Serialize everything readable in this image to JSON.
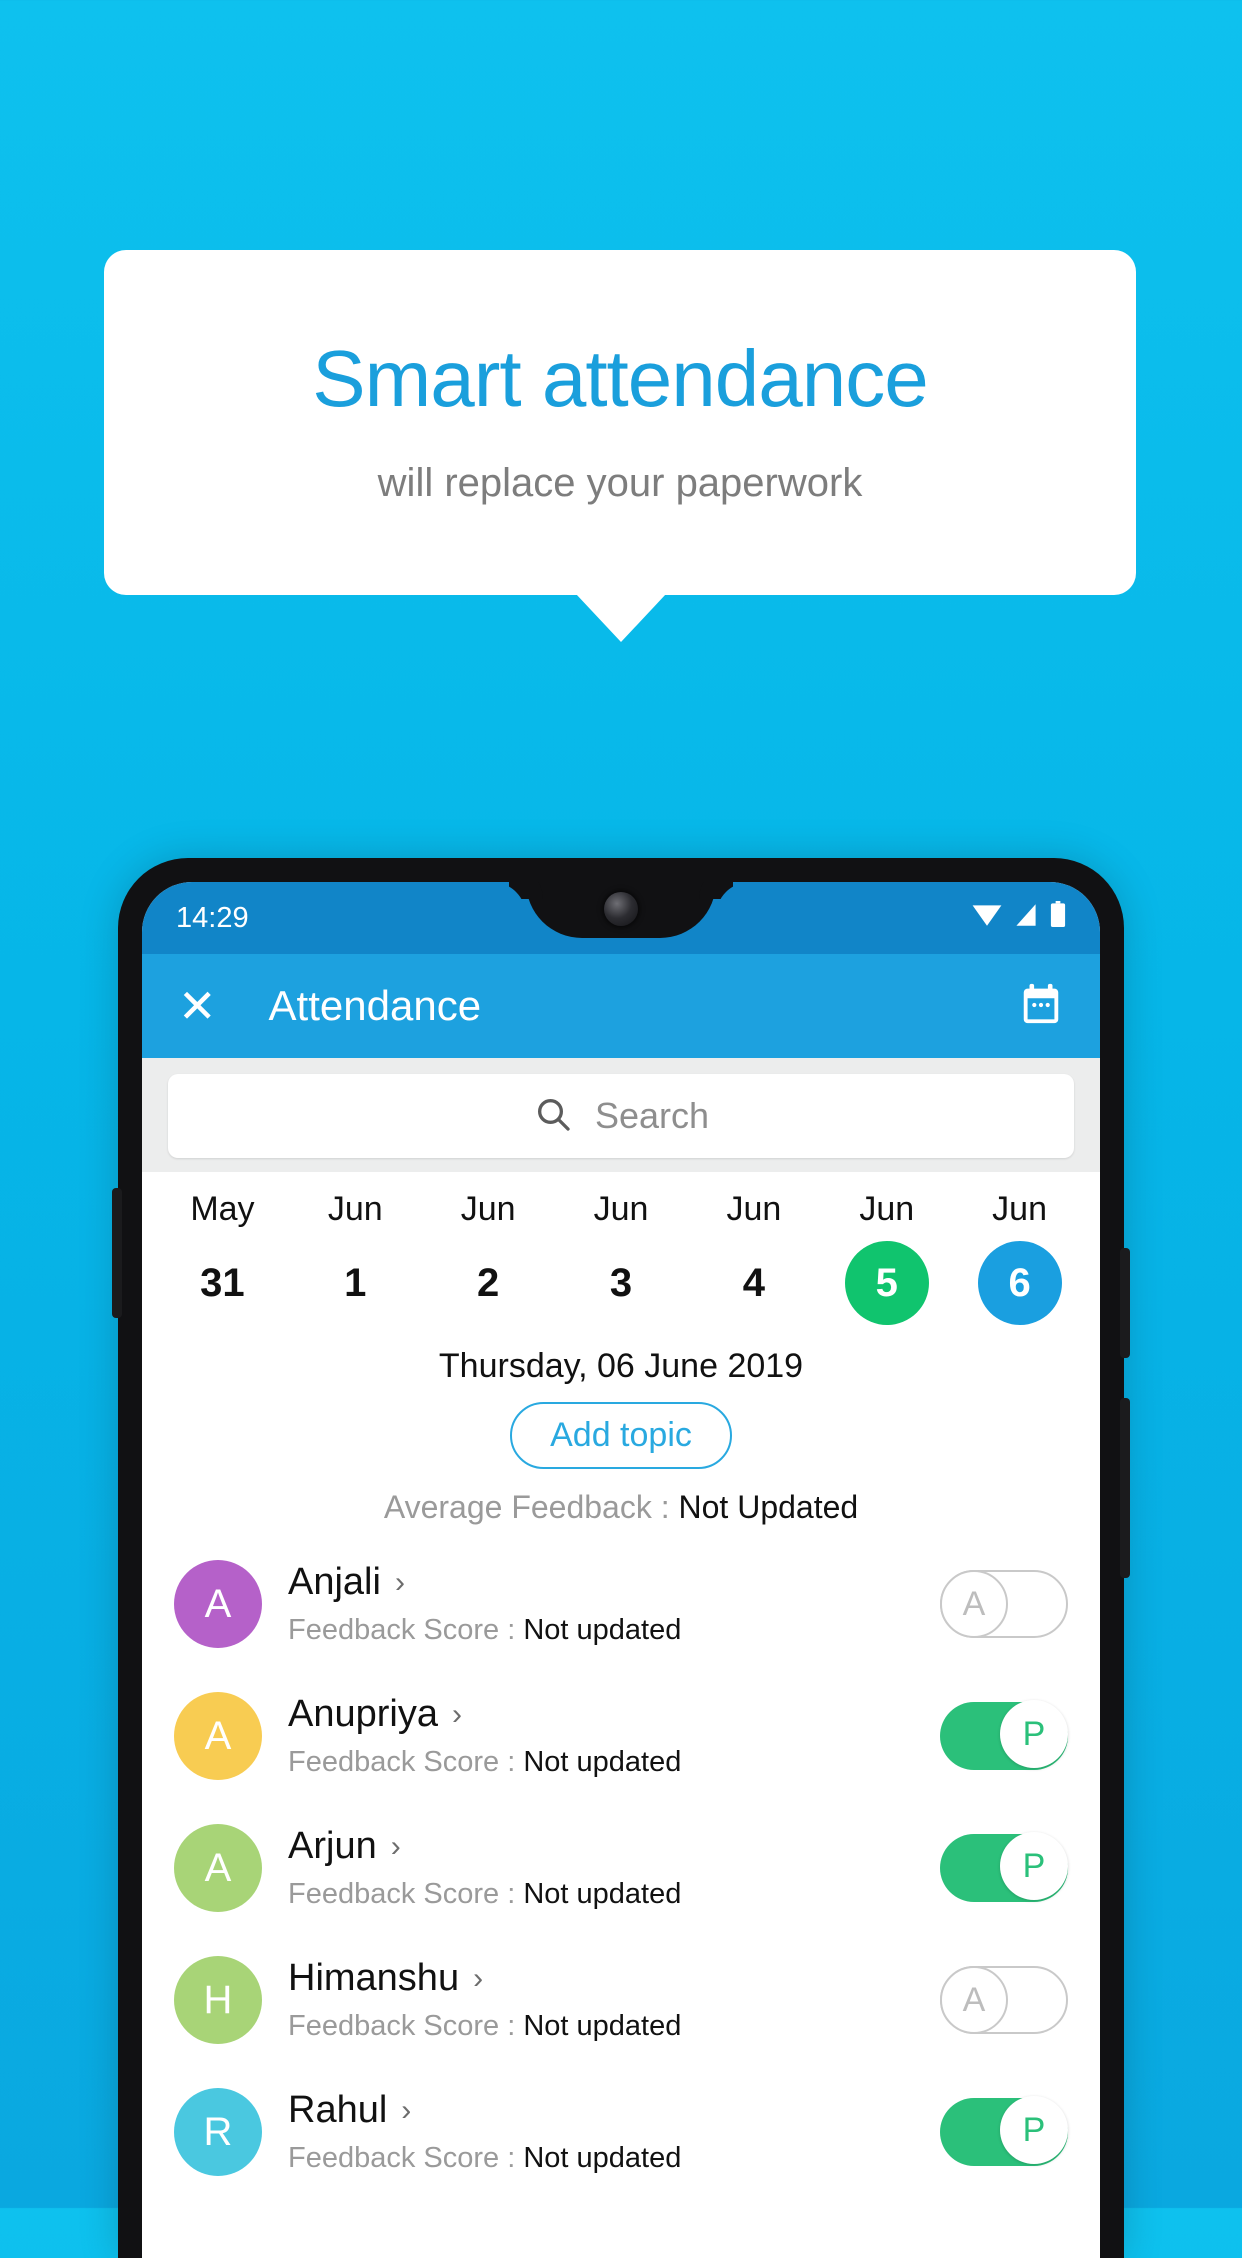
{
  "promo": {
    "title": "Smart attendance",
    "subtitle": "will replace your paperwork"
  },
  "phone": {
    "status": {
      "time": "14:29",
      "icons": [
        "wifi-icon",
        "signal-icon",
        "battery-icon"
      ]
    },
    "appbar": {
      "close_label": "✕",
      "title": "Attendance",
      "calendar_icon": "calendar-icon"
    },
    "search": {
      "placeholder": "Search",
      "value": "",
      "icon": "search-icon"
    },
    "date_strip": [
      {
        "month": "May",
        "day": "31",
        "state": "normal"
      },
      {
        "month": "Jun",
        "day": "1",
        "state": "normal"
      },
      {
        "month": "Jun",
        "day": "2",
        "state": "normal"
      },
      {
        "month": "Jun",
        "day": "3",
        "state": "normal"
      },
      {
        "month": "Jun",
        "day": "4",
        "state": "normal"
      },
      {
        "month": "Jun",
        "day": "5",
        "state": "today"
      },
      {
        "month": "Jun",
        "day": "6",
        "state": "selected"
      }
    ],
    "selected_date_label": "Thursday, 06 June 2019",
    "add_topic_label": "Add topic",
    "average_feedback": {
      "label": "Average Feedback : ",
      "value": "Not Updated"
    },
    "feedback_label": "Feedback Score : ",
    "students": [
      {
        "name": "Anjali",
        "initial": "A",
        "avatar_color": "#b561c9",
        "feedback": "Not updated",
        "status": "A",
        "present": false
      },
      {
        "name": "Anupriya",
        "initial": "A",
        "avatar_color": "#f8cc52",
        "feedback": "Not updated",
        "status": "P",
        "present": true
      },
      {
        "name": "Arjun",
        "initial": "A",
        "avatar_color": "#a8d477",
        "feedback": "Not updated",
        "status": "P",
        "present": true
      },
      {
        "name": "Himanshu",
        "initial": "H",
        "avatar_color": "#a8d477",
        "feedback": "Not updated",
        "status": "A",
        "present": false
      },
      {
        "name": "Rahul",
        "initial": "R",
        "avatar_color": "#4ac8e0",
        "feedback": "Not updated",
        "status": "P",
        "present": true
      }
    ],
    "chevron": "›"
  },
  "colors": {
    "background": "#06b6e8",
    "brand_blue": "#1da1df",
    "title_blue": "#1a9fdc",
    "present_green": "#2bc07a",
    "today_green": "#10c46e",
    "selected_blue": "#1a9fe0"
  }
}
